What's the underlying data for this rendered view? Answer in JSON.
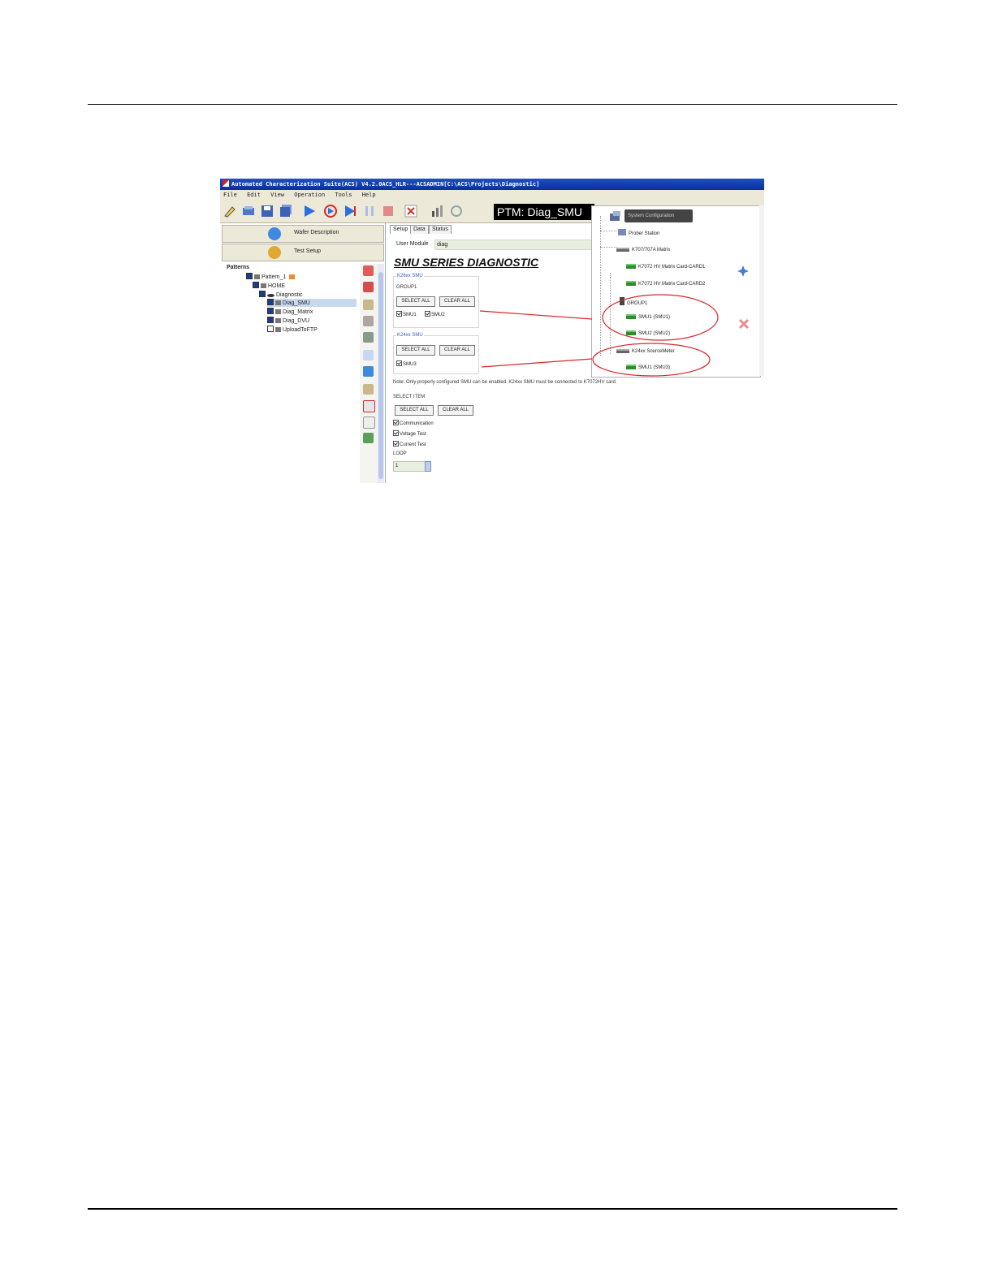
{
  "window": {
    "title": "Automated Characterization Suite(ACS) V4.2.0ACS_HLR---ACSADMIN[C:\\ACS\\Projects\\Diagnostic]"
  },
  "menu": [
    "File",
    "Edit",
    "View",
    "Operation",
    "Tools",
    "Help"
  ],
  "toolbar": {
    "icons": [
      "new-icon",
      "open-icon",
      "save-icon",
      "save-all-icon",
      "run-icon",
      "run-cycle-icon",
      "run-step-icon",
      "pause-icon",
      "stop-icon",
      "abort-icon",
      "chart-icon",
      "refresh-icon"
    ],
    "ptm_label": "PTM: Diag_SMU"
  },
  "left_panel": {
    "wafer_button": "Wafer Description",
    "test_button": "Test Setup",
    "tree": [
      {
        "label": "Patterns",
        "level": 0,
        "checked": false
      },
      {
        "label": "Pattern_1",
        "level": 1,
        "checked": true
      },
      {
        "label": "HOME",
        "level": 2,
        "checked": true
      },
      {
        "label": "Diagnostic",
        "level": 3,
        "checked": true
      },
      {
        "label": "Diag_SMU",
        "level": 4,
        "checked": true,
        "selected": true
      },
      {
        "label": "Diag_Matrix",
        "level": 4,
        "checked": true
      },
      {
        "label": "Diag_DVU",
        "level": 4,
        "checked": true
      },
      {
        "label": "UploadToFTP",
        "level": 4,
        "checked": false
      }
    ]
  },
  "main": {
    "tabs": [
      "Setup",
      "Data",
      "Status"
    ],
    "user_module_label": "User Module",
    "user_module_value": "diag",
    "heading": "SMU SERIES DIAGNOSTIC",
    "group_a": {
      "legend": "K26xx SMU",
      "sublabel": "GROUP1",
      "select_all": "SELECT ALL",
      "clear_all": "CLEAR ALL",
      "checks": [
        "SMU1",
        "SMU2"
      ]
    },
    "group_b": {
      "legend": "K24xx SMU",
      "select_all": "SELECT ALL",
      "clear_all": "CLEAR ALL",
      "checks": [
        "SMU3"
      ]
    },
    "note": "Note: Only properly configured SMU can be enabled. K24xx SMU must be connected to K7072HV card.",
    "select_item": {
      "label": "SELECT ITEM",
      "select_all": "SELECT ALL",
      "clear_all": "CLEAR ALL",
      "checks": [
        "Communication",
        "Voltage Test",
        "Current Test"
      ]
    },
    "loop_label": "LOOP",
    "loop_value": "1"
  },
  "config_popup": {
    "root": "System Configuration",
    "items": [
      "Prober Station",
      "K707/707A Matrix",
      "K7072 HV Matrix Card-CARD1",
      "K7072 HV Matrix Card-CARD2",
      "GROUP1",
      "SMU1 (SMU1)",
      "SMU2 (SMU2)",
      "K24xx SourceMeter",
      "SMU1 (SMU3)"
    ]
  },
  "colors": {
    "annotation": "#d9262c",
    "titlebar": "#0a2f9a",
    "accent_blue": "#3a5bbf"
  }
}
